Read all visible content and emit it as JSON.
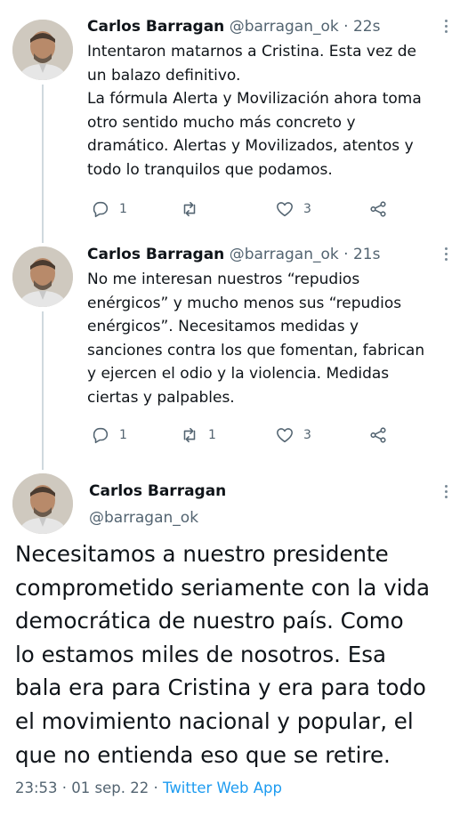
{
  "tweets": [
    {
      "name": "Carlos Barragan",
      "handle": "@barragan_ok",
      "time": "· 22s",
      "lines": [
        "Intentaron matarnos a Cristina. Esta vez de",
        "un balazo definitivo.",
        "La fórmula Alerta y Movilización ahora toma",
        "otro sentido mucho más concreto y",
        "dramático. Alertas y Movilizados, atentos y",
        "todo lo tranquilos que podamos."
      ],
      "replies": "1",
      "retweets": "",
      "likes": "3"
    },
    {
      "name": "Carlos Barragan",
      "handle": "@barragan_ok",
      "time": "· 21s",
      "lines": [
        "No me interesan nuestros “repudios",
        "enérgicos” y mucho menos sus “repudios",
        "enérgicos”. Necesitamos medidas y",
        "sanciones contra los que fomentan, fabrican",
        "y ejercen el odio y la violencia. Medidas",
        "ciertas y palpables."
      ],
      "replies": "1",
      "retweets": "1",
      "likes": "3"
    }
  ],
  "main_tweet": {
    "name": "Carlos Barragan",
    "handle": "@barragan_ok",
    "lines": [
      "Necesitamos a nuestro presidente",
      "comprometido seriamente con la vida",
      "democrática de nuestro país. Como",
      "lo estamos miles de nosotros. Esa",
      "bala era para Cristina y era para todo",
      "el movimiento nacional y popular, el",
      "que no entienda eso que se retire."
    ],
    "timestamp": "23:53 · 01 sep. 22 · ",
    "source": "Twitter Web App"
  },
  "icons": {
    "reply": "reply-icon",
    "retweet": "retweet-icon",
    "like": "heart-icon",
    "share": "share-icon",
    "more": "more-icon"
  },
  "colors": {
    "text": "#0f1419",
    "secondary": "#536471",
    "link": "#1d9bf0",
    "thread_line": "#cfd9de"
  }
}
